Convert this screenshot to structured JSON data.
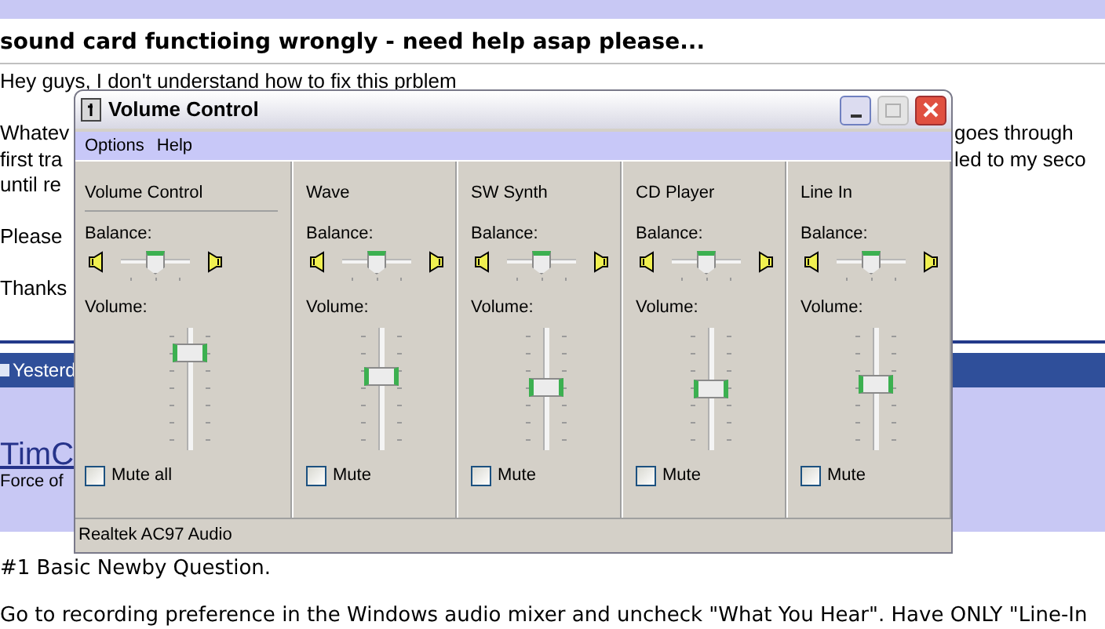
{
  "page": {
    "thread_title": "sound card functioing wrongly - need help asap please...",
    "post_lines": [
      {
        "kind": "text",
        "left": "Hey guys, I don't understand how to fix this prblem"
      },
      {
        "kind": "blank"
      },
      {
        "kind": "text",
        "left": "Whatev",
        "right": "goes through"
      },
      {
        "kind": "text",
        "left": "first tra",
        "right": "led to my seco"
      },
      {
        "kind": "text",
        "left": "until re"
      },
      {
        "kind": "blank"
      },
      {
        "kind": "text",
        "left": "Please"
      },
      {
        "kind": "blank"
      },
      {
        "kind": "text",
        "left": "Thanks"
      }
    ],
    "reply_bar": "Yesterd",
    "author": "TimC",
    "author_title": "Force of",
    "reply_lines": [
      "#1 Basic Newby Question.",
      "Go to recording preference in the Windows audio mixer and uncheck \"What You Hear\". Have ONLY \"Line-In"
    ]
  },
  "window": {
    "title": "Volume Control",
    "menu": [
      "Options",
      "Help"
    ],
    "channels": [
      {
        "kind": "master",
        "name": "Volume Control",
        "balance_label": "Balance:",
        "balance": {
          "level": 0.5
        },
        "volume_label": "Volume:",
        "volume": {
          "level": 0.85
        },
        "mute_label": "Mute all",
        "muted": false
      },
      {
        "kind": "line",
        "name": "Wave",
        "balance_label": "Balance:",
        "balance": {
          "level": 0.5
        },
        "volume_label": "Volume:",
        "volume": {
          "level": 0.62
        },
        "mute_label": "Mute",
        "muted": false
      },
      {
        "kind": "line",
        "name": "SW Synth",
        "balance_label": "Balance:",
        "balance": {
          "level": 0.5
        },
        "volume_label": "Volume:",
        "volume": {
          "level": 0.52
        },
        "mute_label": "Mute",
        "muted": false
      },
      {
        "kind": "line",
        "name": "CD Player",
        "balance_label": "Balance:",
        "balance": {
          "level": 0.5
        },
        "volume_label": "Volume:",
        "volume": {
          "level": 0.5
        },
        "mute_label": "Mute",
        "muted": false
      },
      {
        "kind": "line",
        "name": "Line In",
        "balance_label": "Balance:",
        "balance": {
          "level": 0.5
        },
        "volume_label": "Volume:",
        "volume": {
          "level": 0.55
        },
        "mute_label": "Mute",
        "muted": false
      }
    ],
    "status_bar": "Realtek AC97 Audio"
  }
}
